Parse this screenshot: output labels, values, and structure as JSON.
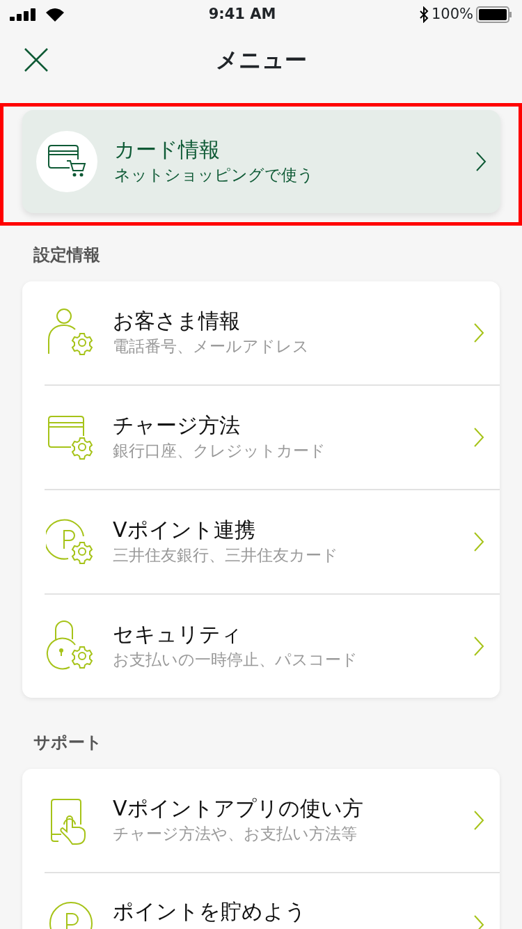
{
  "status_bar": {
    "time": "9:41 AM",
    "battery": "100%"
  },
  "header": {
    "title": "メニュー"
  },
  "featured": {
    "title": "カード情報",
    "subtitle": "ネットショッピングで使う",
    "highlighted": true
  },
  "sections": [
    {
      "label": "設定情報",
      "items": [
        {
          "title": "お客さま情報",
          "subtitle": "電話番号、メールアドレス"
        },
        {
          "title": "チャージ方法",
          "subtitle": "銀行口座、クレジットカード"
        },
        {
          "title": "Vポイント連携",
          "subtitle": "三井住友銀行、三井住友カード"
        },
        {
          "title": "セキュリティ",
          "subtitle": "お支払いの一時停止、パスコード"
        }
      ]
    },
    {
      "label": "サポート",
      "items": [
        {
          "title": "Vポイントアプリの使い方",
          "subtitle": "チャージ方法や、お支払い方法等"
        },
        {
          "title": "ポイントを貯めよう"
        }
      ]
    }
  ]
}
